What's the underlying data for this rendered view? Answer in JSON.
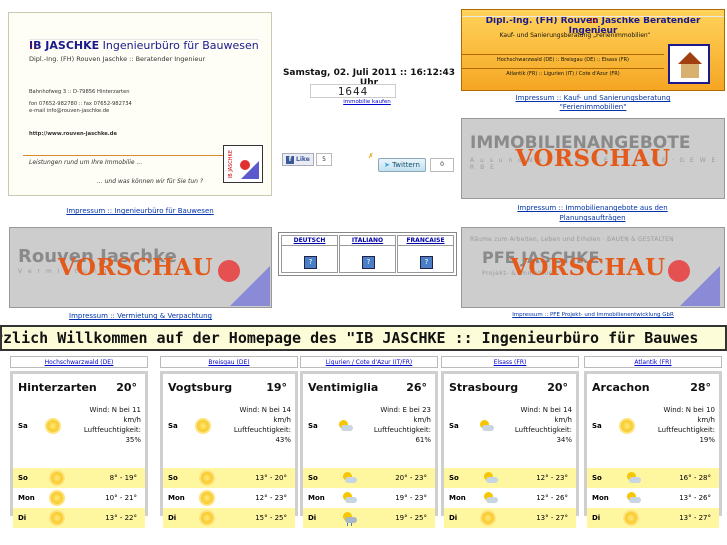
{
  "card": {
    "brand": "IB JASCHKE",
    "brand_sep": "::",
    "brand_rest": "Ingenieurbüro für Bauwesen",
    "subtitle": "Dipl.-Ing. (FH) Rouven Jaschke :: Beratender Ingenieur",
    "address1": "Bahnhofweg 3 :: D-79856 Hinterzarten",
    "address2": "fon 07652-982780 :: fax 07652-982734",
    "address3": "e-mail info@rouven-jaschke.de",
    "web": "http://www.rouven-jaschke.de",
    "tagline1": "Leistungen rund um Ihre Immobilie ...",
    "tagline2": "... und was können wir für Sie tun ?",
    "stamp_text": "IB JASCHKE"
  },
  "card_caption": "Impressum :: Ingenieurbüro für Bauwesen",
  "banner": {
    "title_a": "Dipl.-Ing. (FH) Rouven Jaschke",
    "title_sep": "::",
    "title_b": "Beratender Ingenieur",
    "line2": "Kauf- und Sanierungsberatung „Ferienimmobilien“",
    "bar1": "Hochschwarzwald (DE) :: Breisgau (DE) :: Elsass (FR)",
    "bar2": "Atlantik (FR) :: Ligurien (IT) / Cote d'Azur (FR)"
  },
  "banner_caption": "Impressum :: Kauf- und Sanierungsberatung \"Ferienimmobilien\"",
  "datetime": "Samstag, 02. Juli 2011 :: 16:12:43 Uhr",
  "counter": "1644",
  "buy_link": "immobilie kaufen",
  "social": {
    "like_label": "Like",
    "like_count": "5",
    "twitter_label": "Twittern",
    "twitter_count": "0"
  },
  "tiles": {
    "immobilien": {
      "bg": "IMMOBILIENANGEBOTE",
      "bgsub": "A u s  u n d  N e u b a u   ·   T E R R A I N E   ·   G E W E R B E",
      "overlay": "VORSCHAU",
      "caption": "Impressum :: Immobilienangebote aus den Planungsaufträgen"
    },
    "rouven": {
      "bg": "Rouven Jaschke",
      "bgsub": "V e r m i e t u n g",
      "overlay": "VORSCHAU",
      "caption": "Impressum :: Vermietung & Verpachtung"
    },
    "pfe": {
      "bg": "PFE JASCHKE",
      "bgtop": "Räume zum Arbeiten, Leben und Erholen  ·  BAUEN & GESTALTEN",
      "bgsub": "Projekt- & Immobilien",
      "overlay": "VORSCHAU",
      "caption": "Impressum :: PFE Projekt- und Immobilienentwicklung GbR"
    }
  },
  "languages": [
    {
      "label": "DEUTSCH"
    },
    {
      "label": "ITALIANO"
    },
    {
      "label": "FRANCAISE"
    }
  ],
  "marquee": "rzlich Willkommen auf der Homepage des \"IB JASCHKE :: Ingenieurbüro für Bauwes",
  "weather": [
    {
      "region": "Hochschwarzwald (DE)",
      "city": "Hinterzarten",
      "temp": "20°",
      "today": "Sa",
      "wind": "Wind: N bei 11 km/h",
      "humidity": "Luftfeuchtigkeit: 35%",
      "icon_today": "sun-icon",
      "days": [
        {
          "day": "So",
          "icon": "sun-icon",
          "range": "8° - 19°"
        },
        {
          "day": "Mon",
          "icon": "sun-icon",
          "range": "10° - 21°"
        },
        {
          "day": "Di",
          "icon": "sun-icon",
          "range": "13° - 22°"
        }
      ]
    },
    {
      "region": "Breisgau (DE)",
      "city": "Vogtsburg",
      "temp": "19°",
      "today": "Sa",
      "wind": "Wind: N bei 14 km/h",
      "humidity": "Luftfeuchtigkeit: 43%",
      "icon_today": "sun-icon",
      "days": [
        {
          "day": "So",
          "icon": "sun-icon",
          "range": "13° - 20°"
        },
        {
          "day": "Mon",
          "icon": "sun-icon",
          "range": "12° - 23°"
        },
        {
          "day": "Di",
          "icon": "sun-icon",
          "range": "15° - 25°"
        }
      ]
    },
    {
      "region": "Ligurien / Cote d'Azur (IT/FR)",
      "city": "Ventimiglia",
      "temp": "26°",
      "today": "Sa",
      "wind": "Wind: E bei 23 km/h",
      "humidity": "Luftfeuchtigkeit: 61%",
      "icon_today": "partly-cloudy-icon",
      "days": [
        {
          "day": "So",
          "icon": "partly-cloudy-icon",
          "range": "20° - 23°"
        },
        {
          "day": "Mon",
          "icon": "partly-cloudy-icon",
          "range": "19° - 23°"
        },
        {
          "day": "Di",
          "icon": "rain-cloud-icon",
          "range": "19° - 25°"
        }
      ]
    },
    {
      "region": "Elsass (FR)",
      "city": "Strasbourg",
      "temp": "20°",
      "today": "Sa",
      "wind": "Wind: N bei 14 km/h",
      "humidity": "Luftfeuchtigkeit: 34%",
      "icon_today": "partly-cloudy-icon",
      "days": [
        {
          "day": "So",
          "icon": "partly-cloudy-icon",
          "range": "12° - 23°"
        },
        {
          "day": "Mon",
          "icon": "partly-cloudy-icon",
          "range": "12° - 26°"
        },
        {
          "day": "Di",
          "icon": "sun-icon",
          "range": "13° - 27°"
        }
      ]
    },
    {
      "region": "Atlantik (FR)",
      "city": "Arcachon",
      "temp": "28°",
      "today": "Sa",
      "wind": "Wind: N bei 10 km/h",
      "humidity": "Luftfeuchtigkeit: 19%",
      "icon_today": "sun-icon",
      "days": [
        {
          "day": "So",
          "icon": "partly-cloudy-icon",
          "range": "16° - 28°"
        },
        {
          "day": "Mon",
          "icon": "partly-cloudy-icon",
          "range": "13° - 26°"
        },
        {
          "day": "Di",
          "icon": "sun-icon",
          "range": "13° - 27°"
        }
      ]
    }
  ]
}
